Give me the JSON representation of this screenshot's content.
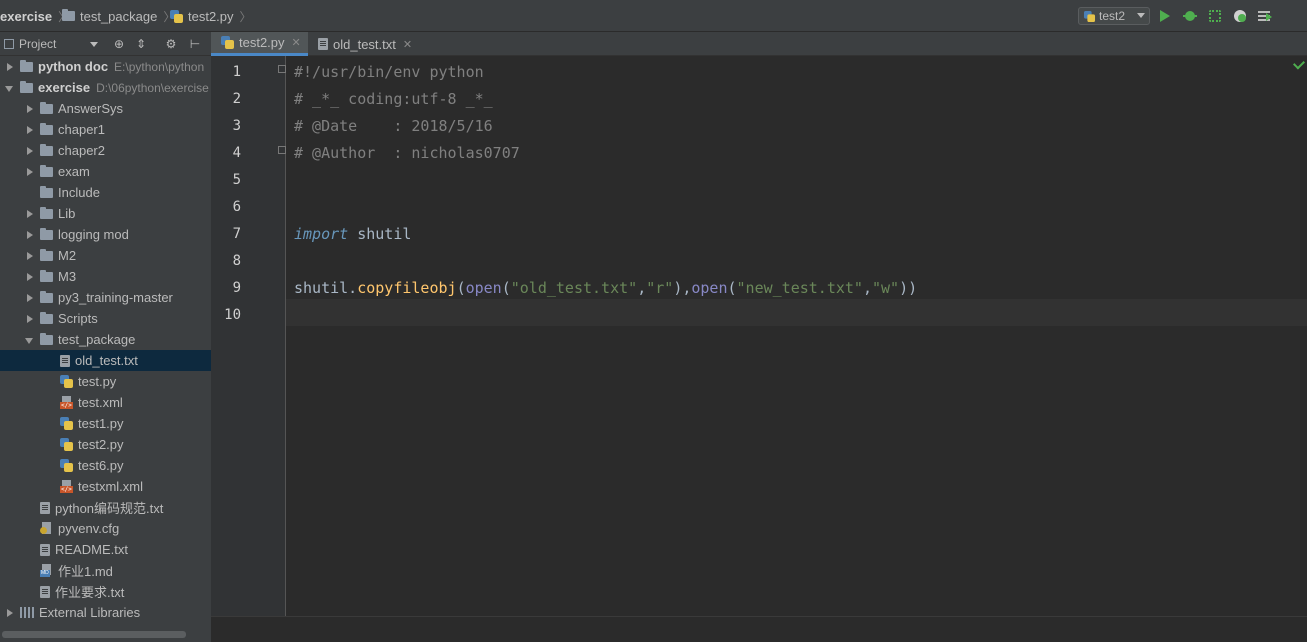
{
  "breadcrumb": {
    "items": [
      {
        "label": "exercise"
      },
      {
        "label": "test_package"
      },
      {
        "label": "test2.py"
      }
    ]
  },
  "toolbar": {
    "run_config": "test2",
    "icons": [
      "run-icon",
      "debug-icon",
      "coverage-icon",
      "profile-icon",
      "concurrency-icon"
    ],
    "accent": "#4fae4f"
  },
  "project_panel": {
    "title": "Project",
    "tree": [
      {
        "label": "python doc",
        "path": "E:\\python\\python",
        "bold": true,
        "expand": "right",
        "icon": "folder",
        "indent": 0
      },
      {
        "label": "exercise",
        "path": "D:\\06python\\exercise",
        "bold": true,
        "expand": "down",
        "icon": "folder",
        "indent": 0
      },
      {
        "label": "AnswerSys",
        "expand": "right",
        "icon": "folder",
        "indent": 1
      },
      {
        "label": "chaper1",
        "expand": "right",
        "icon": "folder",
        "indent": 1
      },
      {
        "label": "chaper2",
        "expand": "right",
        "icon": "folder",
        "indent": 1
      },
      {
        "label": "exam",
        "expand": "right",
        "icon": "folder",
        "indent": 1
      },
      {
        "label": "Include",
        "expand": "none",
        "icon": "folder",
        "indent": 1
      },
      {
        "label": "Lib",
        "expand": "right",
        "icon": "folder",
        "indent": 1
      },
      {
        "label": "logging mod",
        "expand": "right",
        "icon": "folder",
        "indent": 1
      },
      {
        "label": "M2",
        "expand": "right",
        "icon": "folder",
        "indent": 1
      },
      {
        "label": "M3",
        "expand": "right",
        "icon": "folder",
        "indent": 1
      },
      {
        "label": "py3_training-master",
        "expand": "right",
        "icon": "folder",
        "indent": 1
      },
      {
        "label": "Scripts",
        "expand": "right",
        "icon": "folder",
        "indent": 1
      },
      {
        "label": "test_package",
        "expand": "down",
        "icon": "folder",
        "indent": 1
      },
      {
        "label": "old_test.txt",
        "expand": "none",
        "icon": "txt",
        "indent": 2,
        "selected": true
      },
      {
        "label": "test.py",
        "expand": "none",
        "icon": "py",
        "indent": 2
      },
      {
        "label": "test.xml",
        "expand": "none",
        "icon": "xml",
        "indent": 2
      },
      {
        "label": "test1.py",
        "expand": "none",
        "icon": "py",
        "indent": 2
      },
      {
        "label": "test2.py",
        "expand": "none",
        "icon": "py",
        "indent": 2
      },
      {
        "label": "test6.py",
        "expand": "none",
        "icon": "py",
        "indent": 2
      },
      {
        "label": "testxml.xml",
        "expand": "none",
        "icon": "xml",
        "indent": 2
      },
      {
        "label": "python编码规范.txt",
        "expand": "none",
        "icon": "txt",
        "indent": 1
      },
      {
        "label": "pyvenv.cfg",
        "expand": "none",
        "icon": "cfg",
        "indent": 1
      },
      {
        "label": "README.txt",
        "expand": "none",
        "icon": "txt",
        "indent": 1
      },
      {
        "label": "作业1.md",
        "expand": "none",
        "icon": "md",
        "indent": 1
      },
      {
        "label": "作业要求.txt",
        "expand": "none",
        "icon": "txt",
        "indent": 1
      },
      {
        "label": "External Libraries",
        "expand": "right",
        "icon": "lib",
        "indent": 0
      }
    ]
  },
  "tabs": [
    {
      "label": "test2.py",
      "icon": "py",
      "active": true
    },
    {
      "label": "old_test.txt",
      "icon": "txt",
      "active": false
    }
  ],
  "editor": {
    "current_line": 10,
    "lines": [
      {
        "n": "1",
        "tokens": [
          {
            "t": "#!/usr/bin/env python",
            "c": "com"
          }
        ]
      },
      {
        "n": "2",
        "tokens": [
          {
            "t": "# _*_ coding:utf-8 _*_",
            "c": "com"
          }
        ]
      },
      {
        "n": "3",
        "tokens": [
          {
            "t": "# @Date    : 2018/5/16",
            "c": "com"
          }
        ]
      },
      {
        "n": "4",
        "tokens": [
          {
            "t": "# @Author  : nicholas0707",
            "c": "com"
          }
        ]
      },
      {
        "n": "5",
        "tokens": []
      },
      {
        "n": "6",
        "tokens": []
      },
      {
        "n": "7",
        "tokens": [
          {
            "t": "import",
            "c": "kw2"
          },
          {
            "t": " shutil",
            "c": "id"
          }
        ]
      },
      {
        "n": "8",
        "tokens": []
      },
      {
        "n": "9",
        "tokens": [
          {
            "t": "shutil.",
            "c": "id"
          },
          {
            "t": "copyfileobj",
            "c": "fn"
          },
          {
            "t": "(",
            "c": "pl"
          },
          {
            "t": "open",
            "c": "bi"
          },
          {
            "t": "(",
            "c": "pl"
          },
          {
            "t": "\"old_test.txt\"",
            "c": "str"
          },
          {
            "t": ",",
            "c": "pl"
          },
          {
            "t": "\"r\"",
            "c": "str"
          },
          {
            "t": "),",
            "c": "pl"
          },
          {
            "t": "open",
            "c": "bi"
          },
          {
            "t": "(",
            "c": "pl"
          },
          {
            "t": "\"new_test.txt\"",
            "c": "str"
          },
          {
            "t": ",",
            "c": "pl"
          },
          {
            "t": "\"w\"",
            "c": "str"
          },
          {
            "t": "))",
            "c": "pl"
          }
        ]
      },
      {
        "n": "10",
        "tokens": []
      }
    ]
  }
}
